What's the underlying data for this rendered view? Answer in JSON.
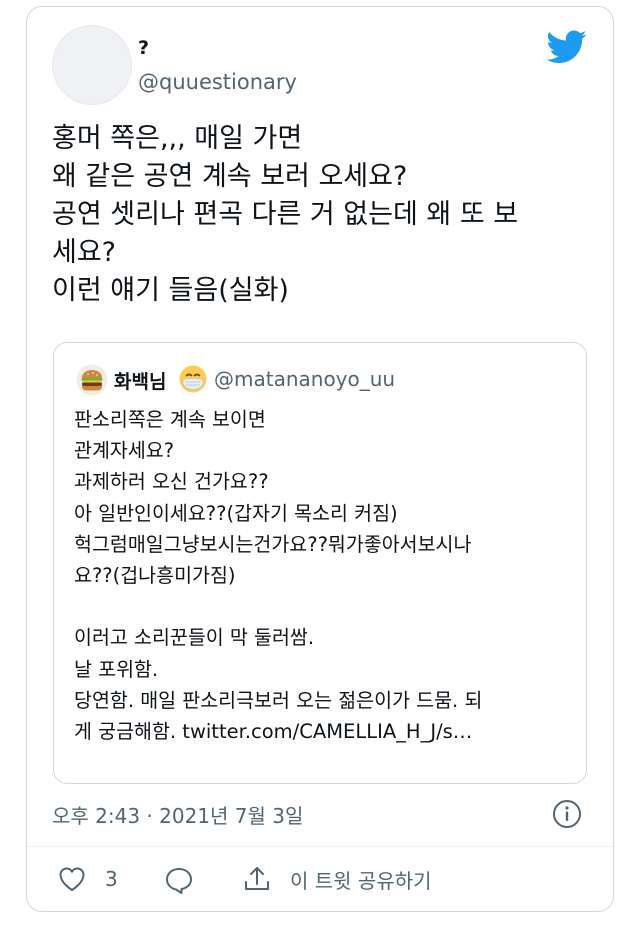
{
  "tweet": {
    "display_name": "?",
    "handle": "@quuestionary",
    "lines": [
      "홍머 쪽은,,, 매일 가면",
      "왜 같은 공연 계속 보러 오세요?",
      "공연 셋리나 편곡 다른 거 없는데 왜 또 보",
      "세요?",
      "이런 얘기 들음(실화)"
    ],
    "timestamp": "오후 2:43 · 2021년 7월 3일"
  },
  "quote": {
    "display_name": "화백님",
    "handle": "@matananoyo_uu",
    "lines": [
      "판소리쪽은 계속 보이면",
      "관계자세요?",
      "과제하러 오신 건가요??",
      "아 일반인이세요??(갑자기 목소리 커짐)",
      "헉그럼매일그냥보시는건가요??뭐가좋아서보시나",
      "요??(겁나흥미가짐)",
      "",
      "이러고 소리꾼들이 막 둘러쌈.",
      "날 포위함.",
      "당연함. 매일 판소리극보러 오는 젊은이가 드뭄. 되",
      "게 궁금해함. twitter.com/CAMELLIA_H_J/s…"
    ]
  },
  "actions": {
    "like_count": "3",
    "share_label": "이 트윗 공유하기"
  },
  "icons": {
    "brand": "twitter-bird-icon",
    "info": "info-icon",
    "like": "heart-icon",
    "reply": "reply-icon",
    "share": "share-icon"
  },
  "colors": {
    "brand_blue": "#1d9bf0",
    "secondary_text": "#536471",
    "border": "#cfd9de"
  }
}
